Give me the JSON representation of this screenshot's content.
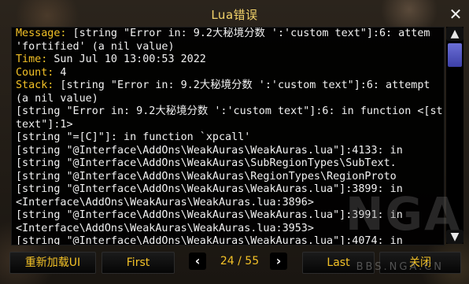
{
  "window": {
    "title": "Lua错误",
    "close_icon": "close-icon"
  },
  "log": {
    "lines": [
      {
        "label": "Message:",
        "text": " [string \"Error in: 9.2大秘境分数 ':'custom text\"]:6: attem"
      },
      {
        "label": "",
        "text": "'fortified' (a nil value)"
      },
      {
        "label": "Time:",
        "text": " Sun Jul 10 13:00:53 2022"
      },
      {
        "label": "Count:",
        "text": " 4"
      },
      {
        "label": "Stack:",
        "text": " [string \"Error in: 9.2大秘境分数 ':'custom text\"]:6: attempt"
      },
      {
        "label": "",
        "text": "(a nil value)"
      },
      {
        "label": "",
        "text": "[string \"Error in: 9.2大秘境分数 ':'custom text\"]:6: in function <[st"
      },
      {
        "label": "",
        "text": "text\"]:1>"
      },
      {
        "label": "",
        "text": "[string \"=[C]\"]: in function `xpcall'"
      },
      {
        "label": "",
        "text": "[string \"@Interface\\AddOns\\WeakAuras\\WeakAuras.lua\"]:4133: in"
      },
      {
        "label": "",
        "text": "[string \"@Interface\\AddOns\\WeakAuras\\SubRegionTypes\\SubText."
      },
      {
        "label": "",
        "text": "[string \"@Interface\\AddOns\\WeakAuras\\RegionTypes\\RegionProto"
      },
      {
        "label": "",
        "text": "[string \"@Interface\\AddOns\\WeakAuras\\WeakAuras.lua\"]:3899: in"
      },
      {
        "label": "",
        "text": "<Interface\\AddOns\\WeakAuras\\WeakAuras.lua:3896>"
      },
      {
        "label": "",
        "text": "[string \"@Interface\\AddOns\\WeakAuras\\WeakAuras.lua\"]:3991: in"
      },
      {
        "label": "",
        "text": "<Interface\\AddOns\\WeakAuras\\WeakAuras.lua:3953>"
      },
      {
        "label": "",
        "text": "[string \"@Interface\\AddOns\\WeakAuras\\WeakAuras.lua\"]:4074: in"
      }
    ]
  },
  "footer": {
    "reload_label": "重新加载UI",
    "first_label": "First",
    "prev_icon": "chevron-left-icon",
    "page_counter": "24 / 55",
    "next_icon": "chevron-right-icon",
    "last_label": "Last",
    "close_label": "关闭"
  },
  "watermark": {
    "main": "NGA",
    "sub": "BBS.NGA.CN"
  },
  "colors": {
    "label": "#f4c227",
    "title": "#f4d46b",
    "text": "#f2f2f2",
    "scroll_thumb": "#5557c8"
  }
}
